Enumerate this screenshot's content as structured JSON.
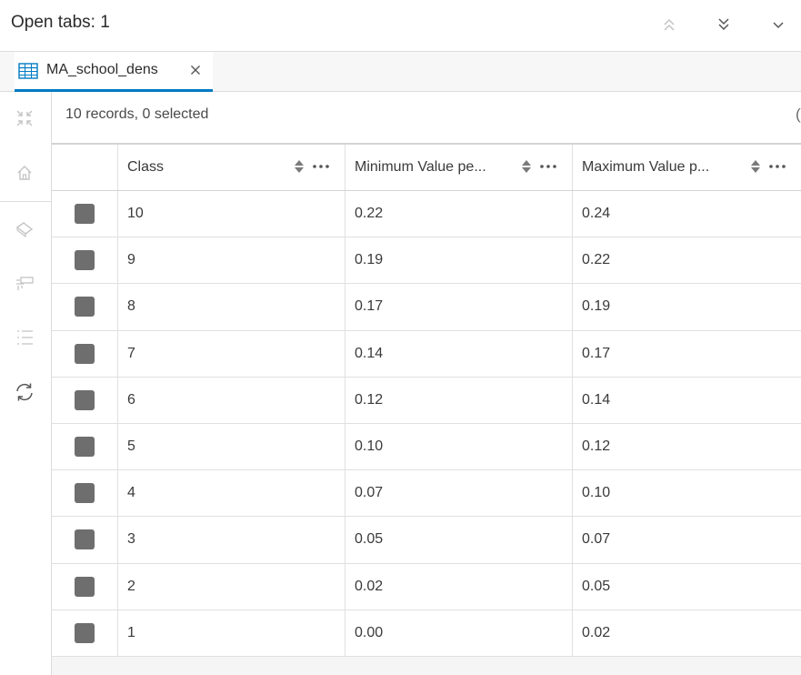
{
  "header": {
    "title": "Open tabs: 1"
  },
  "tab": {
    "label": "MA_school_dens"
  },
  "records": {
    "summary": "10 records, 0 selected",
    "cut_glyph": "("
  },
  "columns": [
    {
      "label": "Class"
    },
    {
      "label": "Minimum Value pe..."
    },
    {
      "label": "Maximum Value p..."
    }
  ],
  "rows": [
    {
      "class": "10",
      "min": "0.22",
      "max": "0.24",
      "color": "#6e6e6e"
    },
    {
      "class": "9",
      "min": "0.19",
      "max": "0.22",
      "color": "#6e6e6e"
    },
    {
      "class": "8",
      "min": "0.17",
      "max": "0.19",
      "color": "#6e6e6e"
    },
    {
      "class": "7",
      "min": "0.14",
      "max": "0.17",
      "color": "#6e6e6e"
    },
    {
      "class": "6",
      "min": "0.12",
      "max": "0.14",
      "color": "#6e6e6e"
    },
    {
      "class": "5",
      "min": "0.10",
      "max": "0.12",
      "color": "#6e6e6e"
    },
    {
      "class": "4",
      "min": "0.07",
      "max": "0.10",
      "color": "#6e6e6e"
    },
    {
      "class": "3",
      "min": "0.05",
      "max": "0.07",
      "color": "#6e6e6e"
    },
    {
      "class": "2",
      "min": "0.02",
      "max": "0.05",
      "color": "#6e6e6e"
    },
    {
      "class": "1",
      "min": "0.00",
      "max": "0.02",
      "color": "#6e6e6e"
    }
  ],
  "colors": {
    "accent": "#007ac2",
    "swatch": "#6e6e6e"
  }
}
